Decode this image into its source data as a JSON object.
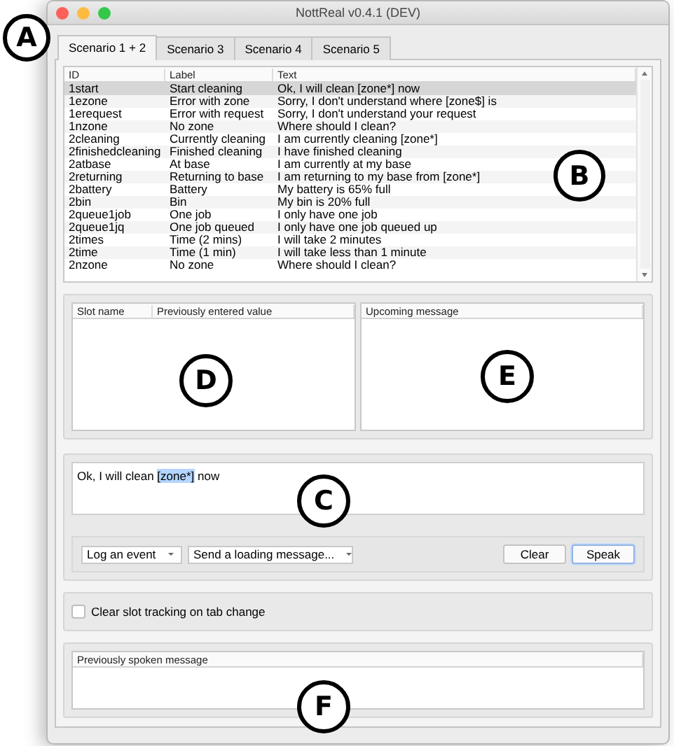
{
  "window": {
    "title": "NottReal v0.4.1 (DEV)"
  },
  "tabs": [
    {
      "label": "Scenario 1 + 2",
      "selected": true
    },
    {
      "label": "Scenario 3",
      "selected": false
    },
    {
      "label": "Scenario 4",
      "selected": false
    },
    {
      "label": "Scenario 5",
      "selected": false
    }
  ],
  "messages_table": {
    "columns": [
      "ID",
      "Label",
      "Text"
    ],
    "rows": [
      {
        "id": "1start",
        "label": "Start cleaning",
        "text": "Ok, I will clean [zone*] now",
        "selected": true
      },
      {
        "id": "1ezone",
        "label": "Error with zone",
        "text": "Sorry, I don't understand where [zone$] is",
        "selected": false
      },
      {
        "id": "1erequest",
        "label": "Error with request",
        "text": "Sorry, I don't understand your request",
        "selected": false
      },
      {
        "id": "1nzone",
        "label": "No zone",
        "text": "Where should I clean?",
        "selected": false
      },
      {
        "id": "2cleaning",
        "label": "Currently cleaning",
        "text": "I am currently cleaning [zone*]",
        "selected": false
      },
      {
        "id": "2finishedcleaning",
        "label": "Finished cleaning",
        "text": "I have finished cleaning",
        "selected": false
      },
      {
        "id": "2atbase",
        "label": "At base",
        "text": "I am currently at my base",
        "selected": false
      },
      {
        "id": "2returning",
        "label": "Returning to base",
        "text": "I am returning to my base from [zone*]",
        "selected": false
      },
      {
        "id": "2battery",
        "label": "Battery",
        "text": "My battery is 65% full",
        "selected": false
      },
      {
        "id": "2bin",
        "label": "Bin",
        "text": "My bin is 20% full",
        "selected": false
      },
      {
        "id": "2queue1job",
        "label": "One job",
        "text": "I only have one job",
        "selected": false
      },
      {
        "id": "2queue1jq",
        "label": "One job queued",
        "text": "I only have one job queued up",
        "selected": false
      },
      {
        "id": "2times",
        "label": "Time (2 mins)",
        "text": "I will take 2 minutes",
        "selected": false
      },
      {
        "id": "2time",
        "label": "Time (1 min)",
        "text": "I will take less than 1 minute",
        "selected": false
      },
      {
        "id": "2nzone",
        "label": "No zone",
        "text": "Where should I clean?",
        "selected": false
      }
    ]
  },
  "slots_table": {
    "columns": [
      "Slot name",
      "Previously entered value"
    ]
  },
  "upcoming_table": {
    "columns": [
      "Upcoming message"
    ]
  },
  "message_field": {
    "segments": [
      {
        "text": "Ok, I will clean ",
        "selected": false
      },
      {
        "text": "[zone*]",
        "selected": true
      },
      {
        "text": " now",
        "selected": false
      }
    ]
  },
  "dropdowns": [
    {
      "value": "Log an event"
    },
    {
      "value": "Send a loading message..."
    }
  ],
  "buttons": [
    {
      "label": "Clear",
      "kind": "plain"
    },
    {
      "label": "Speak",
      "kind": "default"
    }
  ],
  "clear_slot_checkbox": {
    "label": "Clear slot tracking on tab change",
    "checked": false
  },
  "spoken_table": {
    "columns": [
      "Previously spoken message"
    ]
  },
  "callouts": [
    {
      "letter": "A"
    },
    {
      "letter": "B"
    },
    {
      "letter": "D"
    },
    {
      "letter": "E"
    },
    {
      "letter": "C"
    },
    {
      "letter": "F"
    }
  ]
}
